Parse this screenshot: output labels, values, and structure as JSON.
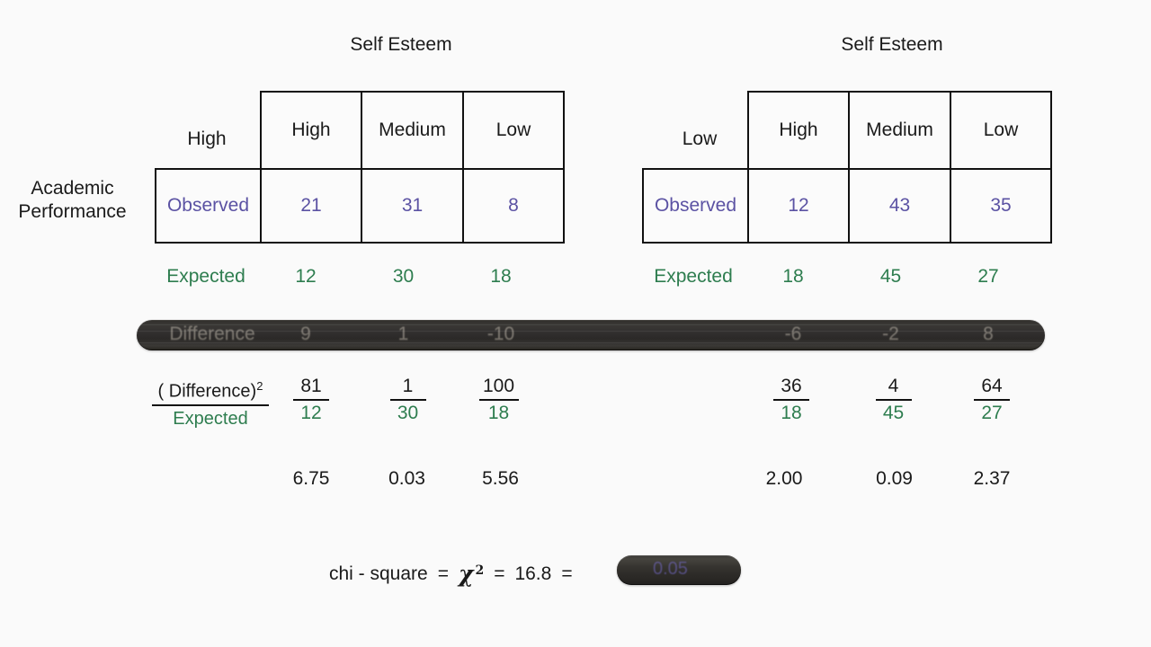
{
  "background_color": "#fafafa",
  "colors": {
    "observed": "#5b52a3",
    "expected": "#2e7d4f",
    "text": "#1a1a1a",
    "border": "#111111",
    "obscure_bar": "#332f2b"
  },
  "panels": [
    {
      "id": "left",
      "column_group_title": "Self Esteem",
      "row_label": "High",
      "column_headers": [
        "High",
        "Medium",
        "Low"
      ],
      "observed_label": "Observed",
      "observed_values": [
        "21",
        "31",
        "8"
      ],
      "expected_label": "Expected",
      "expected_values": [
        "12",
        "30",
        "18"
      ],
      "difference_label": "Difference",
      "difference_values": [
        "9",
        "1",
        "-10"
      ],
      "squared_numerators": [
        "81",
        "1",
        "100"
      ],
      "squared_denominators": [
        "12",
        "30",
        "18"
      ],
      "results": [
        "6.75",
        "0.03",
        "5.56"
      ]
    },
    {
      "id": "right",
      "column_group_title": "Self Esteem",
      "row_label": "Low",
      "column_headers": [
        "High",
        "Medium",
        "Low"
      ],
      "observed_label": "Observed",
      "observed_values": [
        "12",
        "43",
        "35"
      ],
      "expected_label": "Expected",
      "expected_values": [
        "18",
        "45",
        "27"
      ],
      "difference_label": "",
      "difference_values": [
        "-6",
        "-2",
        "8"
      ],
      "squared_numerators": [
        "36",
        "4",
        "64"
      ],
      "squared_denominators": [
        "18",
        "45",
        "27"
      ],
      "results": [
        "2.00",
        "0.09",
        "2.37"
      ]
    }
  ],
  "row_axis_label_line1": "Academic",
  "row_axis_label_line2": "Performance",
  "fraction_label": {
    "numerator": "( Difference)",
    "numerator_superscript": "2",
    "denominator": "Expected"
  },
  "chi_square_line": {
    "text_label": "chi - square",
    "equals_1": "=",
    "symbol": "χ",
    "symbol_superscript": "2",
    "equals_2": "=",
    "value": "16.8",
    "equals_3": "=",
    "obscured_result": "0.05"
  }
}
